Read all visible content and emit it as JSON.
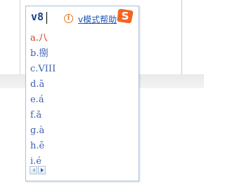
{
  "composition": {
    "text": "v8"
  },
  "help": {
    "icon": "info-circle-icon",
    "label": "v模式帮助"
  },
  "logo": {
    "icon": "sogou-logo-icon",
    "letter": "S",
    "color": "#f26522"
  },
  "candidates": [
    {
      "label": "a.八",
      "selected": true
    },
    {
      "label": "b.捌",
      "selected": false
    },
    {
      "label": "c.VIII",
      "selected": false
    },
    {
      "label": "d.ā",
      "selected": false
    },
    {
      "label": "e.á",
      "selected": false
    },
    {
      "label": "f.ǎ",
      "selected": false
    },
    {
      "label": "g.à",
      "selected": false
    },
    {
      "label": "h.ē",
      "selected": false
    },
    {
      "label": "i.é",
      "selected": false
    }
  ],
  "pager": {
    "prev_icon": "arrow-left-icon",
    "next_icon": "arrow-right-icon"
  },
  "colors": {
    "selected": "#d43a1c",
    "candidate": "#3c5fb0",
    "accent": "#1d56b5",
    "border": "#a9c3de"
  }
}
